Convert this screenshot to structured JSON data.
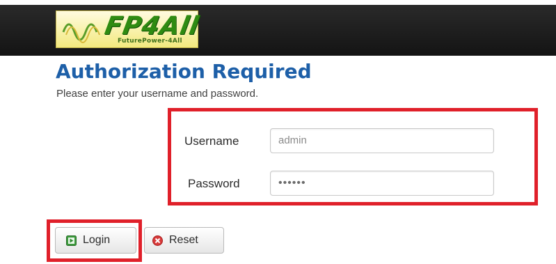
{
  "header": {
    "logo_text": "FP4All",
    "logo_tagline": "FuturePower-4All"
  },
  "page": {
    "title": "Authorization Required",
    "subtitle": "Please enter your username and password."
  },
  "form": {
    "username_label": "Username",
    "username_value": "admin",
    "password_label": "Password",
    "password_masked": "••••••"
  },
  "buttons": {
    "login_label": "Login",
    "reset_label": "Reset",
    "login_icon": "play-icon",
    "reset_icon": "cancel-icon"
  },
  "colors": {
    "header_bg": "#1a1a1a",
    "title": "#1d5fa8",
    "highlight": "#e0202a",
    "login_icon": "#3c9a3c",
    "reset_icon": "#d83a3a"
  }
}
